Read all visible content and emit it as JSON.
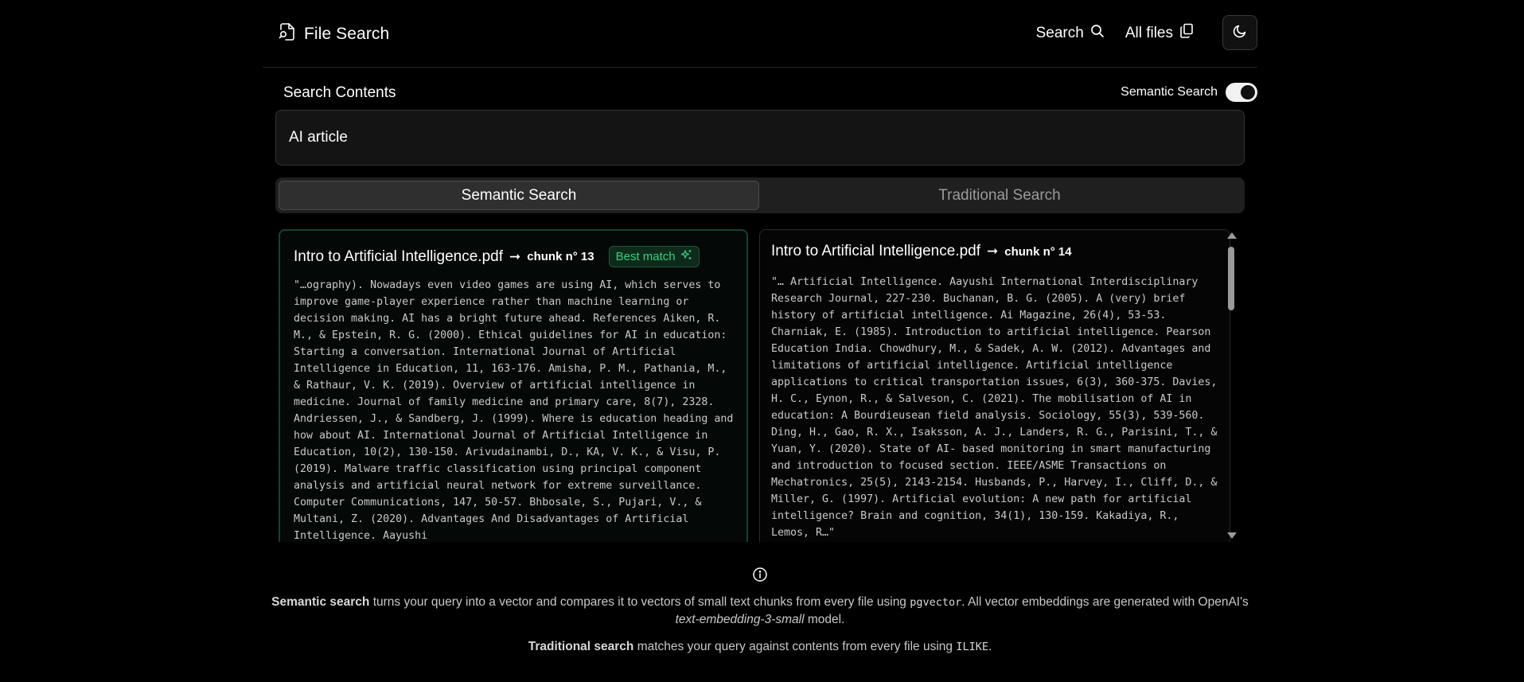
{
  "header": {
    "title": "File Search",
    "nav": {
      "search_label": "Search",
      "all_files_label": "All files"
    }
  },
  "search": {
    "section_label": "Search Contents",
    "semantic_toggle_label": "Semantic Search",
    "semantic_toggle_on": true,
    "query": "AI article"
  },
  "tabs": [
    {
      "label": "Semantic Search",
      "active": true
    },
    {
      "label": "Traditional Search",
      "active": false
    }
  ],
  "results": [
    {
      "file": "Intro to Artificial Intelligence.pdf",
      "arrow": "➞",
      "chunk": "chunk n° 13",
      "badge": "Best match",
      "snippet": "\"…ography). Nowadays even video games are using AI, which serves to improve game-player experience rather than machine learning or decision making. AI has a bright future ahead. References Aiken, R. M., & Epstein, R. G. (2000). Ethical guidelines for AI in education: Starting a conversation. International Journal of Artificial Intelligence in Education, 11, 163-176. Amisha, P. M., Pathania, M., & Rathaur, V. K. (2019). Overview of artificial intelligence in medicine. Journal of family medicine and primary care, 8(7), 2328. Andriessen, J., & Sandberg, J. (1999). Where is education heading and how about AI. International Journal of Artificial Intelligence in Education, 10(2), 130-150. Arivudainambi, D., KA, V. K., & Visu, P. (2019). Malware traffic classification using principal component analysis and artificial neural network for extreme surveillance. Computer Communications, 147, 50-57. Bhbosale, S., Pujari, V., & Multani, Z. (2020). Advantages And Disadvantages of Artificial Intelligence. Aayushi"
    },
    {
      "file": "Intro to Artificial Intelligence.pdf",
      "arrow": "➞",
      "chunk": "chunk n° 14",
      "snippet": "\"… Artificial Intelligence. Aayushi International Interdisciplinary Research Journal, 227-230. Buchanan, B. G. (2005). A (very) brief history of artificial intelligence. Ai Magazine, 26(4), 53-53. Charniak, E. (1985). Introduction to artificial intelligence. Pearson Education India. Chowdhury, M., & Sadek, A. W. (2012). Advantages and limitations of artificial intelligence. Artificial intelligence applications to critical transportation issues, 6(3), 360-375. Davies, H. C., Eynon, R., & Salveson, C. (2021). The mobilisation of AI in education: A Bourdieusean field analysis. Sociology, 55(3), 539-560. Ding, H., Gao, R. X., Isaksson, A. J., Landers, R. G., Parisini, T., & Yuan, Y. (2020). State of AI- based monitoring in smart manufacturing and introduction to focused section. IEEE/ASME Transactions on Mechatronics, 25(5), 2143-2154. Husbands, P., Harvey, I., Cliff, D., & Miller, G. (1997). Artificial evolution: A new path for artificial intelligence? Brain and cognition, 34(1), 130-159. Kakadiya, R., Lemos, R…\""
    }
  ],
  "info": {
    "semantic_term": "Semantic search",
    "semantic_text_1": " turns your query into a vector and compares it to vectors of small text chunks from every file using ",
    "semantic_code": "pgvector",
    "semantic_text_2": ". All vector embeddings are generated with OpenAI's ",
    "model_name": "text-embedding-3-small",
    "semantic_text_3": " model.",
    "traditional_term": "Traditional search",
    "traditional_text": " matches your query against contents from every file using ",
    "traditional_code": "ILIKE",
    "traditional_end": "."
  },
  "colors": {
    "accent_green": "#35d07f",
    "background": "#000000"
  },
  "icons": [
    "file-search-icon",
    "search-icon",
    "copy-files-icon",
    "moon-icon",
    "sparkles-icon",
    "info-icon"
  ]
}
